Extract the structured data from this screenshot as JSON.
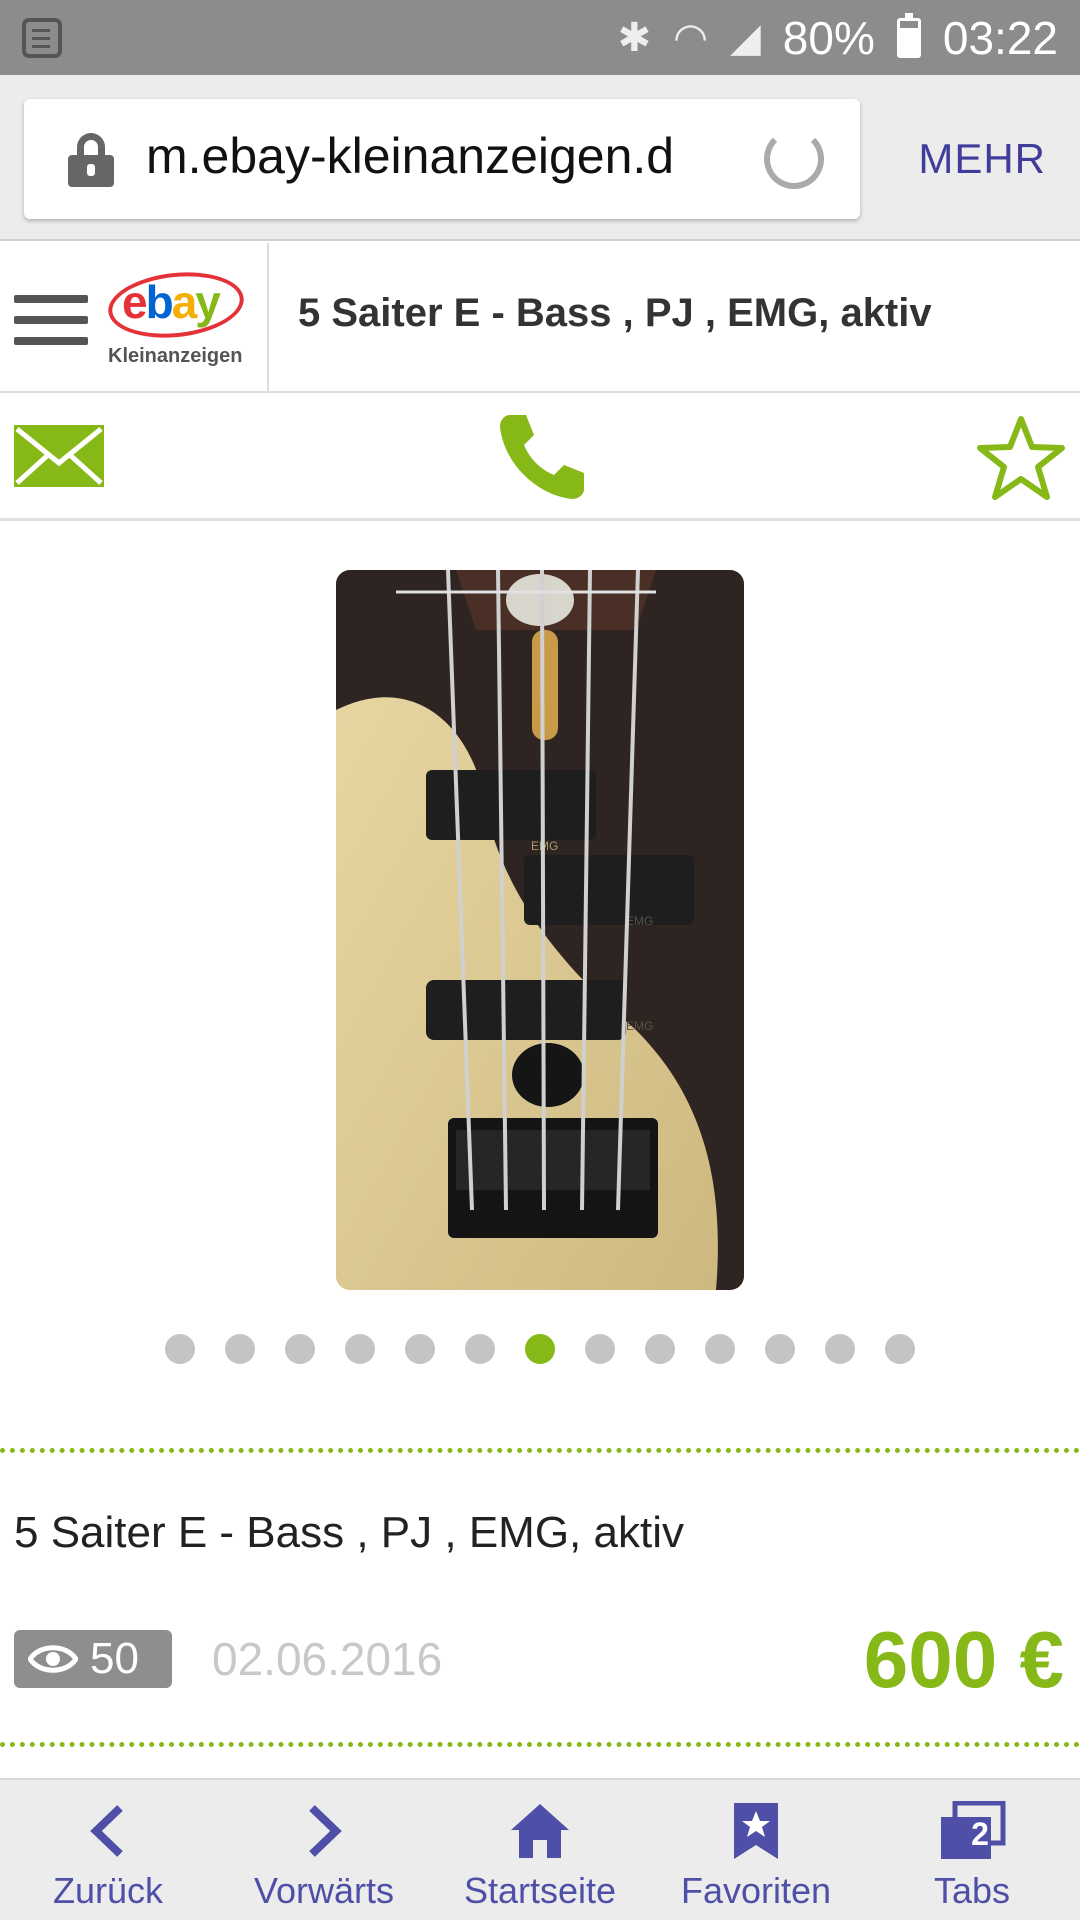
{
  "status_bar": {
    "battery": "80%",
    "time": "03:22"
  },
  "browser": {
    "url": "m.ebay-kleinanzeigen.d",
    "more_label": "MEHR"
  },
  "site": {
    "logo_text": "ebay",
    "logo_subtext": "Kleinanzeigen",
    "header_title": "5 Saiter E - Bass , PJ , EMG, aktiv"
  },
  "gallery": {
    "image_count": 13,
    "active_index": 6,
    "photo_labels": [
      "EMG",
      "EMG",
      "EMG"
    ]
  },
  "listing": {
    "title": "5 Saiter E - Bass , PJ , EMG, aktiv",
    "views": "50",
    "date": "02.06.2016",
    "price": "600 €"
  },
  "bottom_nav": {
    "items": [
      {
        "label": "Zurück",
        "icon": "chevron-left-icon"
      },
      {
        "label": "Vorwärts",
        "icon": "chevron-right-icon"
      },
      {
        "label": "Startseite",
        "icon": "home-icon"
      },
      {
        "label": "Favoriten",
        "icon": "bookmark-star-icon"
      },
      {
        "label": "Tabs",
        "icon": "tabs-icon",
        "badge": "2"
      }
    ]
  },
  "colors": {
    "accent_green": "#86b817",
    "nav_purple": "#4e4fa6",
    "status_bar": "#8c8c8c"
  }
}
